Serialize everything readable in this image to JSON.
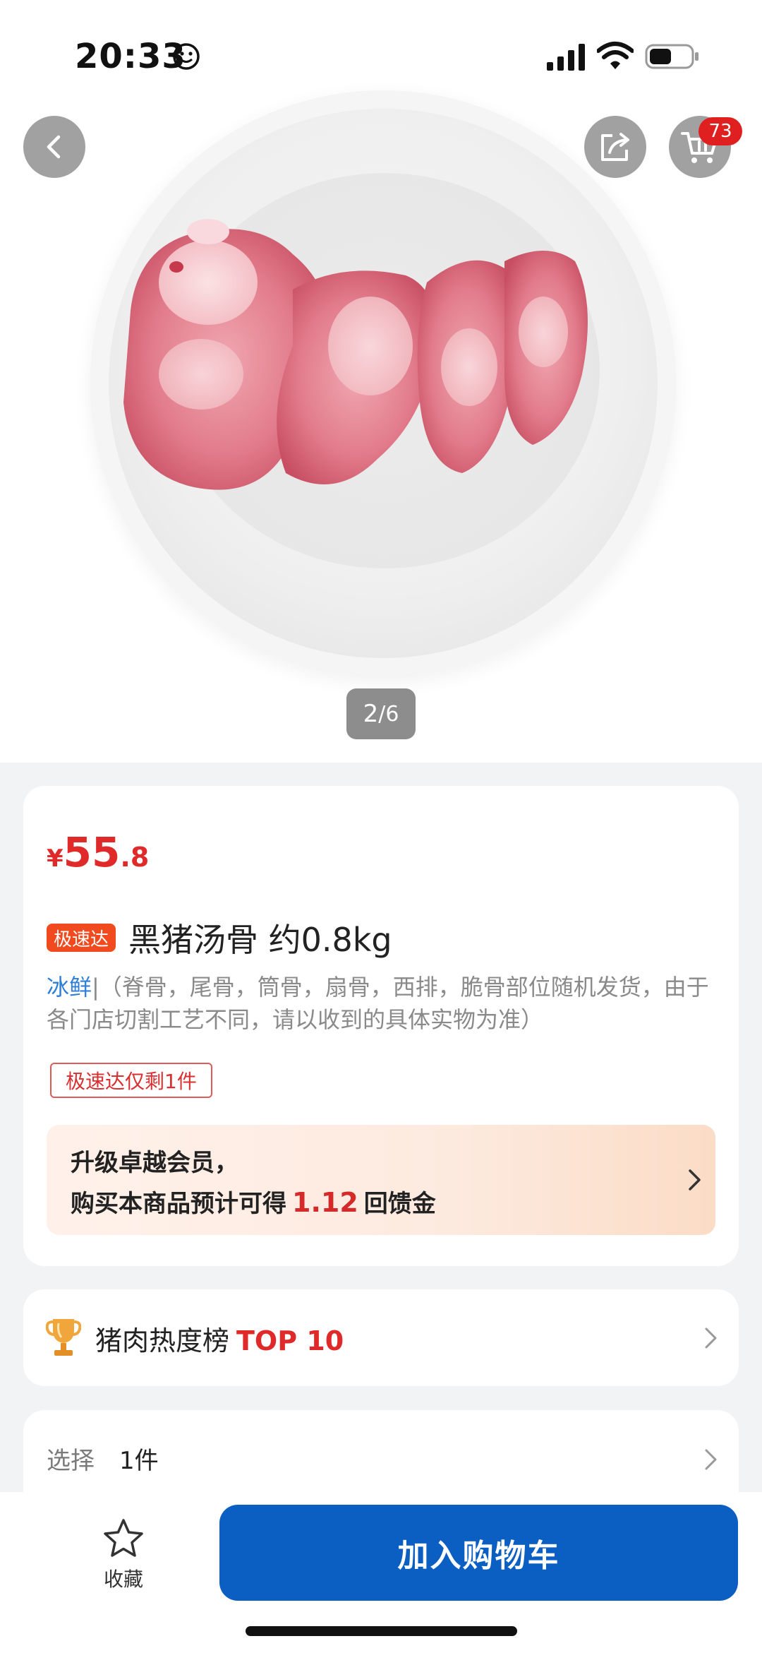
{
  "status_bar": {
    "time": "20:33"
  },
  "header": {
    "cart_badge": "73"
  },
  "gallery": {
    "page_current": "2",
    "page_total": "6"
  },
  "product": {
    "price_symbol": "¥",
    "price_int": "55",
    "price_dec": ".8",
    "speed_badge": "极速达",
    "title": "黑猪汤骨 约0.8kg",
    "fresh_tag": "冰鲜",
    "description": "|（脊骨，尾骨，筒骨，扇骨，西排，脆骨部位随机发货，由于各门店切割工艺不同，请以收到的具体实物为准）",
    "stock_tag": "极速达仅剩1件"
  },
  "member_banner": {
    "line1": "升级卓越会员，",
    "line2_prefix": "购买本商品预计可得",
    "amount": "1.12",
    "line2_suffix": "回馈金"
  },
  "ranking": {
    "label": "猪肉热度榜",
    "top": "TOP 10"
  },
  "selection": {
    "label": "选择",
    "value": "1件"
  },
  "bottom_bar": {
    "favorite_label": "收藏",
    "add_to_cart_label": "加入购物车"
  },
  "colors": {
    "price_red": "#e02a2a",
    "primary_blue": "#0b5ec2",
    "speed_orange": "#f04a1e",
    "fresh_blue": "#2f7fd6"
  },
  "icons": [
    "back-icon",
    "share-icon",
    "cart-icon",
    "chevron-right-icon",
    "trophy-icon",
    "star-icon"
  ]
}
